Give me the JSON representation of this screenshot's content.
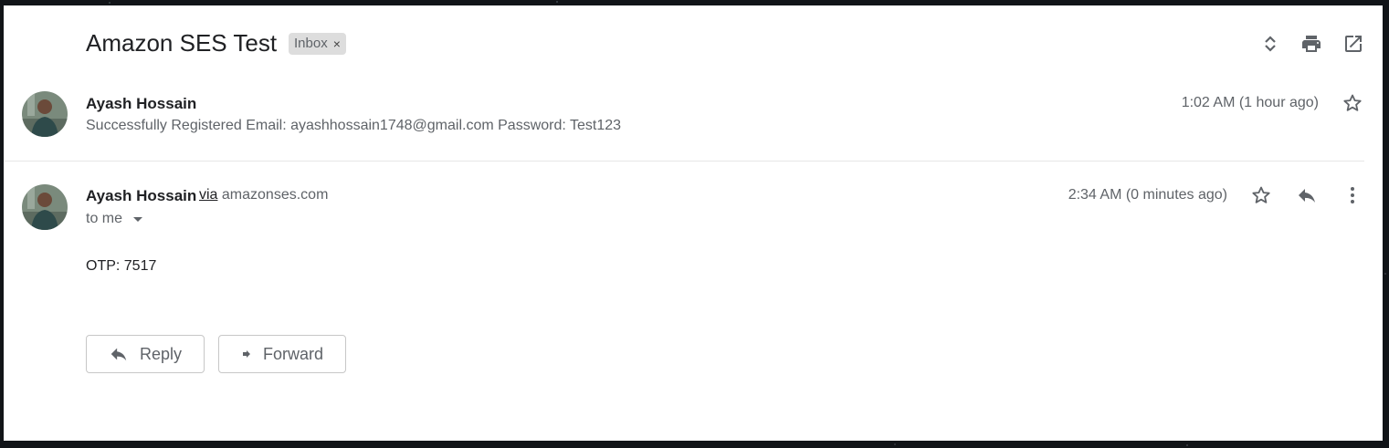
{
  "thread": {
    "subject": "Amazon SES Test",
    "label": "Inbox",
    "label_remove": "×"
  },
  "toolbar": {
    "icons": [
      "expand-collapse-icon",
      "print-icon",
      "open-in-new-window-icon"
    ]
  },
  "message1": {
    "sender": "Ayash Hossain",
    "snippet": "Successfully Registered Email: ayashhossain1748@gmail.com Password: Test123",
    "time": "1:02 AM (1 hour ago)"
  },
  "message2": {
    "sender": "Ayash Hossain",
    "via_word": "via",
    "via_domain": "amazonses.com",
    "recipient": "to me",
    "time": "2:34 AM (0 minutes ago)",
    "body": "OTP: 7517"
  },
  "actions": {
    "reply": "Reply",
    "forward": "Forward"
  },
  "colors": {
    "text_primary": "#202124",
    "text_secondary": "#5f6368",
    "chip_bg": "#dddddd",
    "divider": "#e6e6e6"
  }
}
